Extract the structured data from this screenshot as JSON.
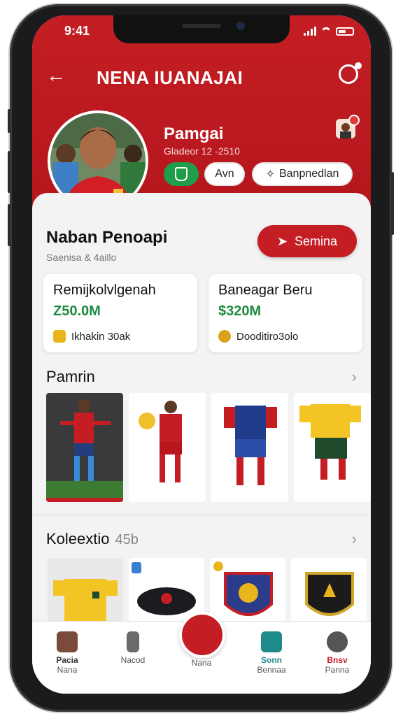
{
  "status_bar": {
    "time": "9:41"
  },
  "header": {
    "title": "NENA IUANAJAI"
  },
  "profile": {
    "name": "Pamgai",
    "subtitle": "Gladeor 12 -2510",
    "green_pill_icon": "shield-icon",
    "pill_2_label": "Avn",
    "pill_3_label": "Banpnedlan"
  },
  "overview": {
    "title": "Naban Penoapi",
    "subtitle": "Saenisa & 4aillo",
    "cta_label": "Semina"
  },
  "stats": [
    {
      "title": "Remijkolvlgenah",
      "value": "Z50.0M",
      "foot": "Ikhakin 30ak",
      "icon": "trophy-icon"
    },
    {
      "title": "Baneagar Beru",
      "value": "$320M",
      "foot": "Dooditiro3olo",
      "icon": "ball-icon"
    }
  ],
  "players_section": {
    "title": "Pamrin"
  },
  "collection_section": {
    "title": "Koleextio",
    "count": "45b"
  },
  "tabbar": {
    "items": [
      {
        "icon": "home-icon",
        "label_top": "Pacia",
        "label_bottom": "Nana"
      },
      {
        "icon": "trash-icon",
        "label_top": "",
        "label_bottom": "Nacod"
      },
      {
        "icon": "center-bell-icon",
        "label_top": "",
        "label_bottom": "Nana"
      },
      {
        "icon": "shirt-icon",
        "label_top": "Sonn",
        "label_bottom": "Bennaa"
      },
      {
        "icon": "profile-icon",
        "label_top": "Bnsv",
        "label_bottom": "Panna"
      }
    ]
  },
  "colors": {
    "brand_red": "#c41e24",
    "accent_green": "#1e8b40",
    "pill_green": "#1f9d4b"
  }
}
